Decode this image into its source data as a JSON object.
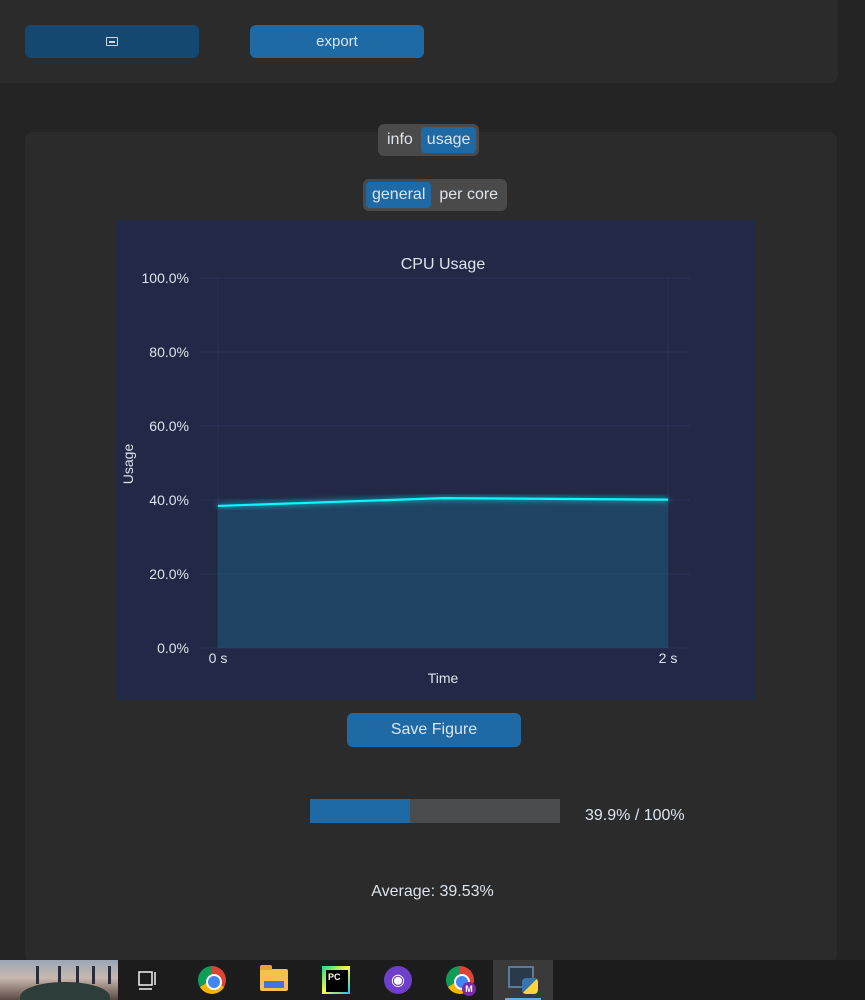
{
  "toolbar": {
    "icon_button": {
      "icon": "archive-icon"
    },
    "export_label": "export"
  },
  "tabs": {
    "main": [
      {
        "label": "info",
        "active": false
      },
      {
        "label": "usage",
        "active": true
      }
    ],
    "sub": [
      {
        "label": "general",
        "active": true
      },
      {
        "label": "per core",
        "active": false
      }
    ]
  },
  "chart_data": {
    "type": "area",
    "title": "CPU Usage",
    "xlabel": "Time",
    "ylabel": "Usage",
    "x_ticks": [
      "0 s",
      "2 s"
    ],
    "y_ticks": [
      "0.0%",
      "20.0%",
      "40.0%",
      "60.0%",
      "80.0%",
      "100.0%"
    ],
    "xlim": [
      0,
      2
    ],
    "ylim": [
      0,
      100
    ],
    "x": [
      0,
      1,
      2
    ],
    "values": [
      38.4,
      40.5,
      40.1
    ],
    "grid": true,
    "colors": {
      "background": "#212946",
      "line": "#08f7fe",
      "fill": "#1f4e6e",
      "grid": "#2a3459",
      "text": "#dce4ee"
    }
  },
  "save_figure_label": "Save Figure",
  "progress": {
    "value": 0.399,
    "text": "39.9% / 100%"
  },
  "average_text": "Average: 39.53%",
  "taskbar": {
    "items": [
      {
        "name": "task-view-icon"
      },
      {
        "name": "chrome-icon"
      },
      {
        "name": "file-explorer-icon"
      },
      {
        "name": "pycharm-icon"
      },
      {
        "name": "github-desktop-icon"
      },
      {
        "name": "chrome-profile-icon",
        "badge": "M"
      },
      {
        "name": "python-app-icon",
        "active": true
      }
    ]
  }
}
